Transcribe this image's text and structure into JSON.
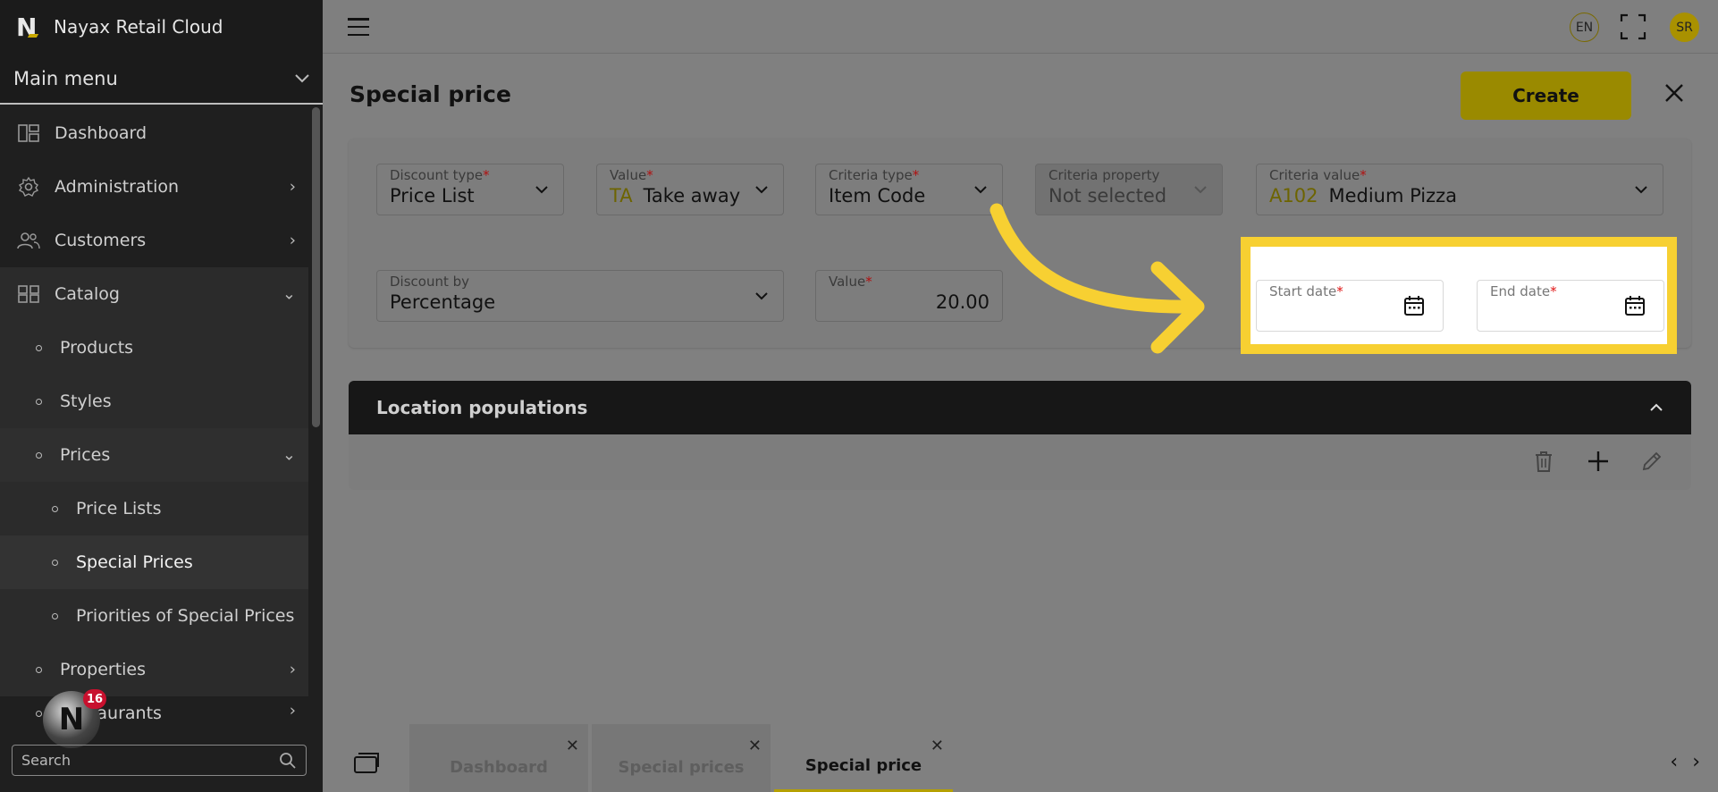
{
  "app": {
    "title": "Nayax Retail Cloud",
    "logo_letter": "N"
  },
  "sidebar": {
    "main_menu_label": "Main menu",
    "items": [
      {
        "label": "Dashboard",
        "icon": "dashboard-icon"
      },
      {
        "label": "Administration",
        "icon": "gear-icon"
      },
      {
        "label": "Customers",
        "icon": "users-icon"
      },
      {
        "label": "Catalog",
        "icon": "catalog-icon"
      },
      {
        "label": "Products"
      },
      {
        "label": "Styles"
      },
      {
        "label": "Prices"
      },
      {
        "label": "Price Lists"
      },
      {
        "label": "Special Prices"
      },
      {
        "label": "Priorities of Special Prices"
      },
      {
        "label": "Properties"
      },
      {
        "label": "Restaurants"
      }
    ],
    "search_placeholder": "Search",
    "notification_count": "16"
  },
  "topbar": {
    "language": "EN",
    "user_initials": "SR"
  },
  "page": {
    "title": "Special price",
    "create_label": "Create"
  },
  "form": {
    "discount_type": {
      "label": "Discount type",
      "value": "Price List"
    },
    "value_option": {
      "label": "Value",
      "code": "TA",
      "value": "Take away"
    },
    "criteria_type": {
      "label": "Criteria type",
      "value": "Item Code"
    },
    "criteria_property": {
      "label": "Criteria property",
      "value": "Not selected"
    },
    "criteria_value": {
      "label": "Criteria value",
      "code": "A102",
      "value": "Medium Pizza"
    },
    "discount_by": {
      "label": "Discount by",
      "value": "Percentage"
    },
    "discount_value": {
      "label": "Value",
      "value": "20.00"
    },
    "start_date": {
      "label": "Start date",
      "value": ""
    },
    "end_date": {
      "label": "End date",
      "value": ""
    },
    "required_mark": "*"
  },
  "location_populations": {
    "title": "Location populations"
  },
  "bottom_tabs": [
    {
      "label": "Dashboard"
    },
    {
      "label": "Special prices"
    },
    {
      "label": "Special price",
      "active": true
    }
  ],
  "colors": {
    "accent": "#f7d032",
    "brand_yellow": "#d4bd00",
    "required": "#e01515"
  }
}
